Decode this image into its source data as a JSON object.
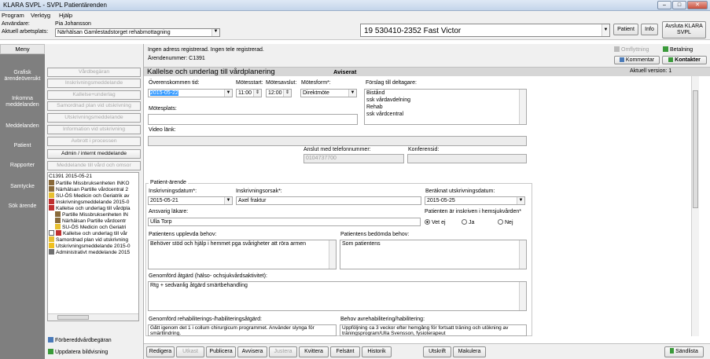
{
  "window": {
    "title": "KLARA SVPL - SVPL Patientärenden"
  },
  "menu": [
    "Program",
    "Verktyg",
    "Hjälp"
  ],
  "user": {
    "user_label": "Användare:",
    "user_value": "Pia Johansson",
    "workplace_label": "Aktuell arbetsplats:",
    "workplace_value": "Närhälsan Gamlestadstorget rehabmottagning"
  },
  "patient": {
    "value": "19 530410-2352 Fast Victor",
    "patient_btn": "Patient",
    "info_btn": "Info",
    "exit_btn": "Avsluta KLARA SVPL"
  },
  "sidebar": {
    "header": "Meny",
    "items": [
      "Grafisk ärendeöversikt",
      "Inkomna meddelanden",
      "Meddelanden",
      "Patient",
      "Rapporter",
      "Samtycke",
      "Sök ärende"
    ]
  },
  "nav": {
    "buttons": [
      "Vårdbegäran",
      "Inskrivningsmeddelande",
      "Kallelse+underlag",
      "Samordnad plan vid utskrivning",
      "Utskrivningsmeddelande",
      "Information vid utskrivning",
      "Avbrott i processen",
      "Admin / internt meddelande",
      "Meddelande till vård och omsor"
    ],
    "tree": [
      "C1391 2015-05-21",
      "Partille Missbruksenheten INKO",
      "Närhälsan Partille vårdcentral 2",
      "SU-ÖS Medicin och Geriatrik av",
      "Inskrivningsmeddelande 2015-0",
      "Kallelse och underlag till vårdpla",
      "Partille Missbruksenheten IN",
      "Närhälsan Partille vårdcentr",
      "SU-ÖS Medicin och Geriatri",
      "Kallelse och underlag till vår",
      "Samordnad plan vid utskrivning",
      "Utskrivningsmeddelande 2015-0",
      "Administrativt meddelande 2015"
    ],
    "bottom_buttons": [
      "Förbereddvårdbegäran",
      "Uppdatera bildvisning"
    ]
  },
  "info": {
    "line1": "Ingen adress registrerad.  Ingen tele registrerad.",
    "line2": "Ärendenummer: C1391",
    "omflyttning": "Omflyttning",
    "betalning": "Betalning",
    "kommentar": "Kommentar",
    "kontakter": "Kontakter"
  },
  "header": {
    "title": "Kallelse och underlag till vårdplanering",
    "status": "Aviserat",
    "version": "Aktuell version: 1"
  },
  "form": {
    "overenskommen_label": "Överenskommen tid:",
    "overenskommen_value": "2015-05-22",
    "motesstart_label": "Mötesstart:",
    "motesstart_value": "11:00",
    "motesavslut_label": "Mötesavslut:",
    "motesavslut_value": "12:00",
    "motesform_label": "Mötesform*:",
    "motesform_value": "Direktmöte",
    "deltagare_label": "Förslag till deltagare:",
    "deltagare": [
      "Bistånd",
      "ssk vårdavdelning",
      "Rehab",
      "ssk vårdcentral"
    ],
    "motesplats_label": "Mötesplats:",
    "video_label": "Video länk:",
    "telefon_label": "Anslut med telefonnummer:",
    "telefon_value": "0104737700",
    "konferens_label": "Konferensid:",
    "patient_arende": "Patient-ärende",
    "inskrivningsdatum_label": "Inskrivningsdatum*:",
    "inskrivningsdatum_value": "2015-05-21",
    "inskrivningsorsak_label": "Inskrivningsorsak*:",
    "inskrivningsorsak_value": "Axel fraktur",
    "utskrivning_label": "Beräknat utskrivningsdatum:",
    "utskrivning_value": "2015-05-25",
    "lakare_label": "Ansvarig läkare:",
    "lakare_value": "Ulla Torp",
    "hemsjukvard_label": "Patienten är inskriven i hemsjukvården*",
    "radio_vetej": "Vet ej",
    "radio_ja": "Ja",
    "radio_nej": "Nej",
    "upplevda_label": "Patientens upplevda behov:",
    "upplevda_value": "Behöver stöd och hjälp i hemmet pga svårigheter att röra armen",
    "bedomda_label": "Patientens bedömda behov:",
    "bedomda_value": "Som patientens",
    "atgard_label": "Genomförd åtgärd (hälso- ochsjukvårdsaktivitet):",
    "atgard_value": "Rtg + sedvanlig åtgärd smärtbehandling",
    "rehab_label": "Genomförd rehabiliterings-/habiliteringsåtgärd:",
    "rehab_value": "Gått igenom det 1 i collum chirurgicum programmet. Använder slynga för smärtlindring.",
    "behov_label": "Behov avrehabilitering/habilitering:",
    "behov_value": "Uppföljning ca 3 veckor efter hemgång för fortsatt träning och utökning av träningsprogram/Ulla Svensson, fysioterapeut"
  },
  "toolbar": {
    "redigera": "Redigera",
    "utkast": "Utkast",
    "publicera": "Publicera",
    "avvisera": "Avvisera",
    "justera": "Justera",
    "kvittera": "Kvittera",
    "felsant": "Felsänt",
    "historik": "Historik",
    "utskrift": "Utskrift",
    "makulera": "Makulera",
    "sandlista": "Sändlista"
  },
  "colors": {
    "sidebar": "#7f7f7f",
    "selection": "#3399ff"
  }
}
